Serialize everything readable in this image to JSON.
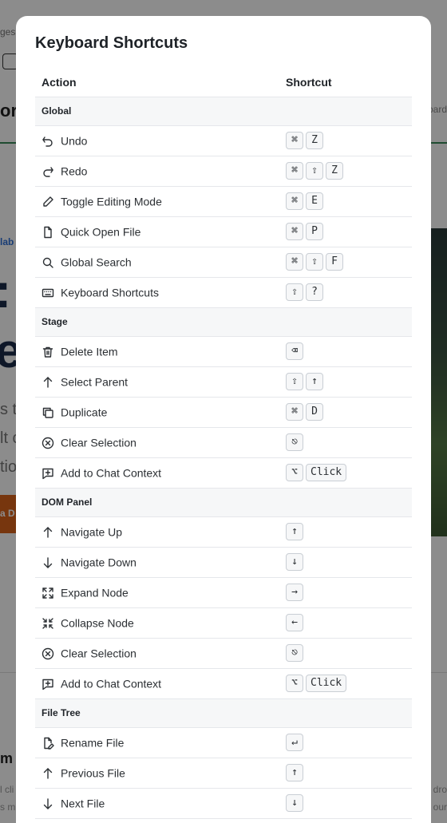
{
  "background": {
    "breadcrumb_fragment": "ges",
    "title_fragment": "or",
    "right_fragment": "bard",
    "badge_fragment": "lab",
    "headline_line1": ": Y",
    "headline_line2": "e",
    "para_lines": [
      "s t",
      "lt c",
      "tio"
    ],
    "cta_fragment": "a D",
    "section_fragment": "m",
    "left_lines": [
      "l cli",
      "s m"
    ],
    "right_lines": [
      "dro",
      "our"
    ]
  },
  "modal": {
    "title": "Keyboard Shortcuts",
    "col_action": "Action",
    "col_shortcut": "Shortcut",
    "sections": [
      {
        "name": "Global",
        "rows": [
          {
            "icon": "undo-icon",
            "label": "Undo",
            "keys": [
              "⌘",
              "Z"
            ]
          },
          {
            "icon": "redo-icon",
            "label": "Redo",
            "keys": [
              "⌘",
              "⇧",
              "Z"
            ]
          },
          {
            "icon": "pencil-icon",
            "label": "Toggle Editing Mode",
            "keys": [
              "⌘",
              "E"
            ]
          },
          {
            "icon": "file-icon",
            "label": "Quick Open File",
            "keys": [
              "⌘",
              "P"
            ]
          },
          {
            "icon": "search-icon",
            "label": "Global Search",
            "keys": [
              "⌘",
              "⇧",
              "F"
            ]
          },
          {
            "icon": "keyboard-icon",
            "label": "Keyboard Shortcuts",
            "keys": [
              "⇧",
              "?"
            ]
          }
        ]
      },
      {
        "name": "Stage",
        "rows": [
          {
            "icon": "trash-icon",
            "label": "Delete Item",
            "keys": [
              "⌫"
            ]
          },
          {
            "icon": "arrow-up-icon",
            "label": "Select Parent",
            "keys": [
              "⇧",
              "↑"
            ]
          },
          {
            "icon": "duplicate-icon",
            "label": "Duplicate",
            "keys": [
              "⌘",
              "D"
            ]
          },
          {
            "icon": "clear-circle-icon",
            "label": "Clear Selection",
            "keys": [
              "⎋"
            ]
          },
          {
            "icon": "chat-plus-icon",
            "label": "Add to Chat Context",
            "keys": [
              "⌥",
              "Click"
            ]
          }
        ]
      },
      {
        "name": "DOM Panel",
        "rows": [
          {
            "icon": "arrow-up-icon",
            "label": "Navigate Up",
            "keys": [
              "↑"
            ]
          },
          {
            "icon": "arrow-down-icon",
            "label": "Navigate Down",
            "keys": [
              "↓"
            ]
          },
          {
            "icon": "expand-icon",
            "label": "Expand Node",
            "keys": [
              "→"
            ]
          },
          {
            "icon": "collapse-icon",
            "label": "Collapse Node",
            "keys": [
              "←"
            ]
          },
          {
            "icon": "clear-circle-icon",
            "label": "Clear Selection",
            "keys": [
              "⎋"
            ]
          },
          {
            "icon": "chat-plus-icon",
            "label": "Add to Chat Context",
            "keys": [
              "⌥",
              "Click"
            ]
          }
        ]
      },
      {
        "name": "File Tree",
        "rows": [
          {
            "icon": "file-edit-icon",
            "label": "Rename File",
            "keys": [
              "↵"
            ]
          },
          {
            "icon": "arrow-up-icon",
            "label": "Previous File",
            "keys": [
              "↑"
            ]
          },
          {
            "icon": "arrow-down-icon",
            "label": "Next File",
            "keys": [
              "↓"
            ]
          },
          {
            "icon": "file-icon",
            "label": "",
            "keys": [
              ""
            ]
          }
        ]
      }
    ]
  }
}
